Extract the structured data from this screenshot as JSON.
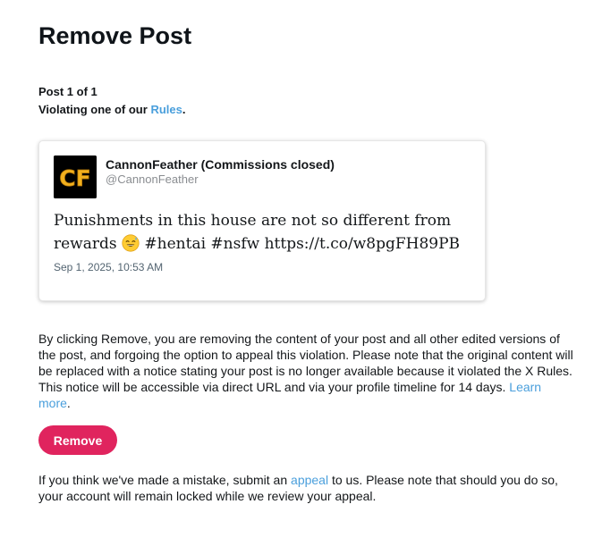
{
  "page": {
    "title": "Remove Post",
    "post_counter": "Post 1 of 1",
    "violation_prefix": "Violating one of our ",
    "violation_link": "Rules",
    "violation_suffix": "."
  },
  "post": {
    "avatar_text": "CF",
    "author_name": "CannonFeather (Commissions closed)",
    "author_handle": "@CannonFeather",
    "text_before_emoji": "Punishments in this house are not so different from rewards ",
    "emoji": "sweat-smile-emoji",
    "text_after_emoji": " #hentai #nsfw https://t.co/w8pgFH89PB",
    "date": "Sep 1, 2025, 10:53 AM"
  },
  "description": {
    "text": "By clicking Remove, you are removing the content of your post and all other edited versions of the post, and forgoing the option to appeal this violation. Please note that the original content will be replaced with a notice stating your post is no longer available because it violated the X Rules. This notice will be accessible via direct URL and via your profile timeline for 14 days. ",
    "learn_more": "Learn more",
    "suffix": "."
  },
  "actions": {
    "remove_label": "Remove"
  },
  "appeal": {
    "prefix": "If you think we've made a mistake, submit an ",
    "link": "appeal",
    "suffix": " to us. Please note that should you do so, your account will remain locked while we review your appeal."
  },
  "colors": {
    "accent_link": "#4a9fdc",
    "remove_button": "#e0245e",
    "avatar_background": "#000000",
    "avatar_letters": "#f2b01e"
  }
}
